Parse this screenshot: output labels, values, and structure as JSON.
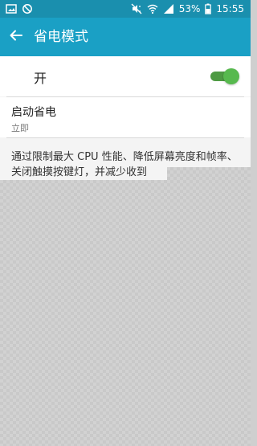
{
  "status_bar": {
    "battery_percent": "53%",
    "time": "15:55",
    "icons": [
      "gallery-icon",
      "blocked-icon",
      "mute-icon",
      "wifi-icon",
      "signal-icon",
      "battery-icon"
    ]
  },
  "app_bar": {
    "title": "省电模式",
    "back_icon": "back-arrow-icon"
  },
  "settings": {
    "master_toggle": {
      "label": "开",
      "enabled": true
    },
    "start_saving": {
      "title": "启动省电",
      "subtitle": "立即"
    },
    "description": "通过限制最大 CPU 性能、降低屏幕亮度和帧率、关闭触摸按键灯，并减少收到"
  },
  "colors": {
    "status_bar": "#1a8fae",
    "app_bar": "#1aa0c5",
    "toggle_on": "#57b94e"
  }
}
